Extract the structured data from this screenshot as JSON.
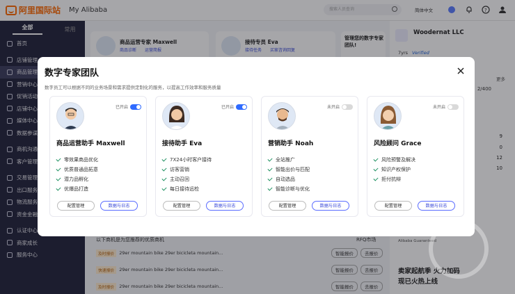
{
  "topbar": {
    "logo_text": "阿里国际站",
    "brand2": "My Alibaba",
    "search_placeholder": "搜索人员查询",
    "lang": "简体中文"
  },
  "sidebar": {
    "tabs": [
      "全部",
      "常用"
    ],
    "items": [
      {
        "label": "首页"
      },
      {
        "label": "店铺管理"
      },
      {
        "label": "商品管理"
      },
      {
        "label": "营销中心"
      },
      {
        "label": "促销活动"
      },
      {
        "label": "店铺中心"
      },
      {
        "label": "媒体中心"
      },
      {
        "label": "数据参谋"
      },
      {
        "label": "商机沟通"
      },
      {
        "label": "客户管理"
      },
      {
        "label": "交易管理"
      },
      {
        "label": "出口服务"
      },
      {
        "label": "物流服务"
      },
      {
        "label": "资金金融"
      },
      {
        "label": "认证中心"
      },
      {
        "label": "商家成长"
      },
      {
        "label": "服务中心"
      }
    ]
  },
  "background": {
    "top_cards": [
      {
        "title": "商品运营专家 Maxwell",
        "sub1": "商品诊断",
        "sub2": "运营简报"
      },
      {
        "title": "接待专员 Eva",
        "sub1": "接待任务",
        "sub2": "买家咨询回复"
      },
      {
        "title": "管理您的数字专家团队!"
      }
    ],
    "company": "Woodernat LLC",
    "company_years": "7yrs",
    "company_badge": "Verified",
    "more": "更多",
    "ratio": "2/400",
    "counts": [
      "9",
      "0",
      "12",
      "10"
    ],
    "rfq_label": "以下商机是为您推荐的优质商机",
    "rfq_market": "RFQ市场",
    "rows": [
      {
        "tag": "及时报价",
        "text": "29er mountain bike 29er bicicleta mountain...",
        "action1": "智能报价",
        "action2": "去报价"
      },
      {
        "tag": "快速报价",
        "text": "29er mountain bike 29er bicicleta mountain...",
        "action1": "智能报价",
        "action2": "去报价"
      },
      {
        "tag": "及时报价",
        "text": "29er mountain bike 29er bicicleta mountain...",
        "action1": "智能报价",
        "action2": "去报价"
      }
    ],
    "promo_title": "卖家起航季 火力加码",
    "promo_sub": "现已火热上线",
    "promo_brand": "Alibaba Guaranteed"
  },
  "modal": {
    "title": "数字专家团队",
    "subtitle": "数字员工可以根据不同的业务场景和需求提供定制化的服务，以提高工作效率和服务质量",
    "agents": [
      {
        "name": "商品运营助手 Maxwell",
        "toggle_label": "已开启",
        "on": true,
        "features": [
          "零效果商品优化",
          "优质普通品拓意",
          "潜力品孵化",
          "优爆品打造"
        ],
        "btn_manage": "配置管理",
        "btn_data": "数据与日志"
      },
      {
        "name": "接待助手 Eva",
        "toggle_label": "已开启",
        "on": true,
        "features": [
          "7X24小时客户接待",
          "访客营销",
          "主动召回",
          "每日接待远检"
        ],
        "btn_manage": "配置管理",
        "btn_data": "数据与日志"
      },
      {
        "name": "营销助手 Noah",
        "toggle_label": "未开启",
        "on": false,
        "features": [
          "全站推广",
          "智能出价与匹配",
          "自动选品",
          "智能诊断与优化"
        ],
        "btn_manage": "配置管理",
        "btn_data": "数据与日志"
      },
      {
        "name": "风险顾问 Grace",
        "toggle_label": "未开启",
        "on": false,
        "features": [
          "风险预警及解决",
          "知识产权保护",
          "拒付抗辩"
        ],
        "btn_manage": "配置管理",
        "btn_data": "数据与日志"
      }
    ]
  }
}
